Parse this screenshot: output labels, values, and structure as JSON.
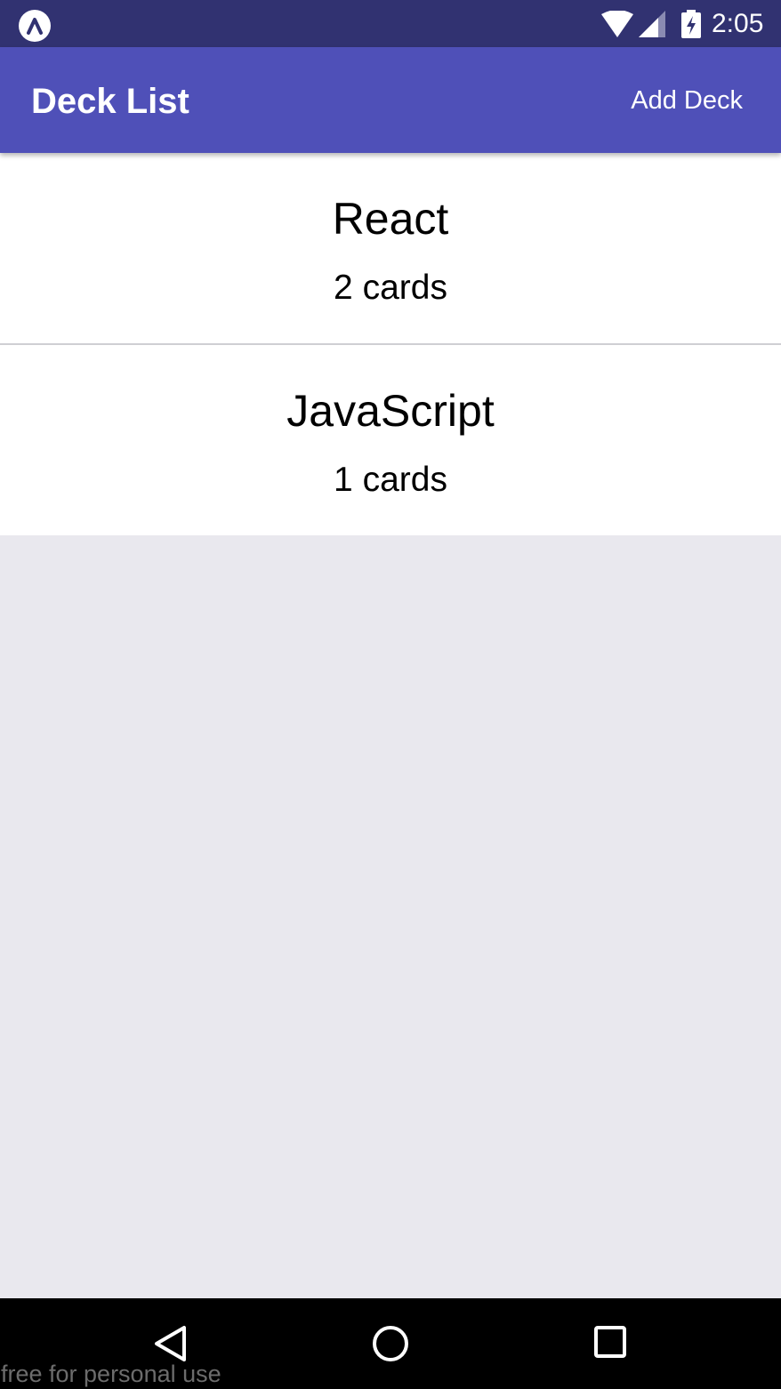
{
  "status_bar": {
    "time": "2:05",
    "icons": [
      "expo-icon",
      "wifi-icon",
      "signal-icon",
      "battery-charging-icon"
    ]
  },
  "header": {
    "title": "Deck List",
    "add_deck_label": "Add Deck"
  },
  "decks": [
    {
      "title": "React",
      "count_label": "2 cards"
    },
    {
      "title": "JavaScript",
      "count_label": "1 cards"
    }
  ],
  "nav_bar": {
    "icons": [
      "back-icon",
      "home-icon",
      "recents-icon"
    ]
  },
  "watermark": "free for personal use",
  "colors": {
    "status_bar": "#313271",
    "header": "#4f50b8",
    "background": "#e9e8ee",
    "card": "#ffffff"
  }
}
